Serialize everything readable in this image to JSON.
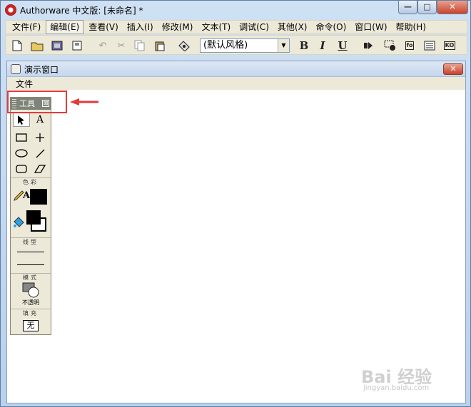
{
  "window": {
    "title": "Authorware 中文版: [未命名] *",
    "controls": {
      "minimize": "—",
      "maximize": "□",
      "close": "✕"
    }
  },
  "menubar": {
    "items": [
      {
        "label": "文件(F)"
      },
      {
        "label": "编辑(E)",
        "active": true
      },
      {
        "label": "查看(V)"
      },
      {
        "label": "插入(I)"
      },
      {
        "label": "修改(M)"
      },
      {
        "label": "文本(T)"
      },
      {
        "label": "调试(C)"
      },
      {
        "label": "其他(X)"
      },
      {
        "label": "命令(O)"
      },
      {
        "label": "窗口(W)"
      },
      {
        "label": "帮助(H)"
      }
    ]
  },
  "toolbar": {
    "text_style": "(默认风格)",
    "bold": "B",
    "italic": "I",
    "underline": "U",
    "fn_label": "fo",
    "ko_label": "KO"
  },
  "presentation_window": {
    "title": "演示窗口",
    "menu": "文件",
    "close": "✕"
  },
  "tool_palette": {
    "title": "工具",
    "close": "⊠",
    "text_tool": "A",
    "color_section": "色彩",
    "text_color_letter": "A",
    "line_section": "线型",
    "mode_section": "模式",
    "mode_value": "不透明",
    "fill_section": "填充",
    "fill_value": "无"
  },
  "watermark": {
    "text": "Bai 经验",
    "sub": "jingyan.baidu.com"
  }
}
